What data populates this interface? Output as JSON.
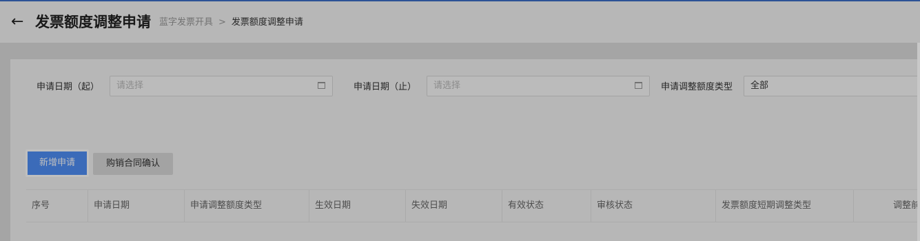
{
  "header": {
    "title": "发票额度调整申请",
    "breadcrumb": [
      "蓝字发票开具",
      "发票额度调整申请"
    ],
    "breadcrumb_separator": ">"
  },
  "filters": {
    "start_date": {
      "label": "申请日期（起）",
      "placeholder": "请选择"
    },
    "end_date": {
      "label": "申请日期（止）",
      "placeholder": "请选择"
    },
    "adjust_type": {
      "label": "申请调整额度类型",
      "value": "全部"
    }
  },
  "actions": {
    "add_label": "新增申请",
    "confirm_label": "购销合同确认"
  },
  "table": {
    "columns": [
      "序号",
      "申请日期",
      "申请调整额度类型",
      "生效日期",
      "失效日期",
      "有效状态",
      "审核状态",
      "发票额度短期调整类型",
      "调整前"
    ]
  },
  "colors": {
    "primary": "#4f8ff7",
    "top_bar": "#3b6ec9"
  }
}
